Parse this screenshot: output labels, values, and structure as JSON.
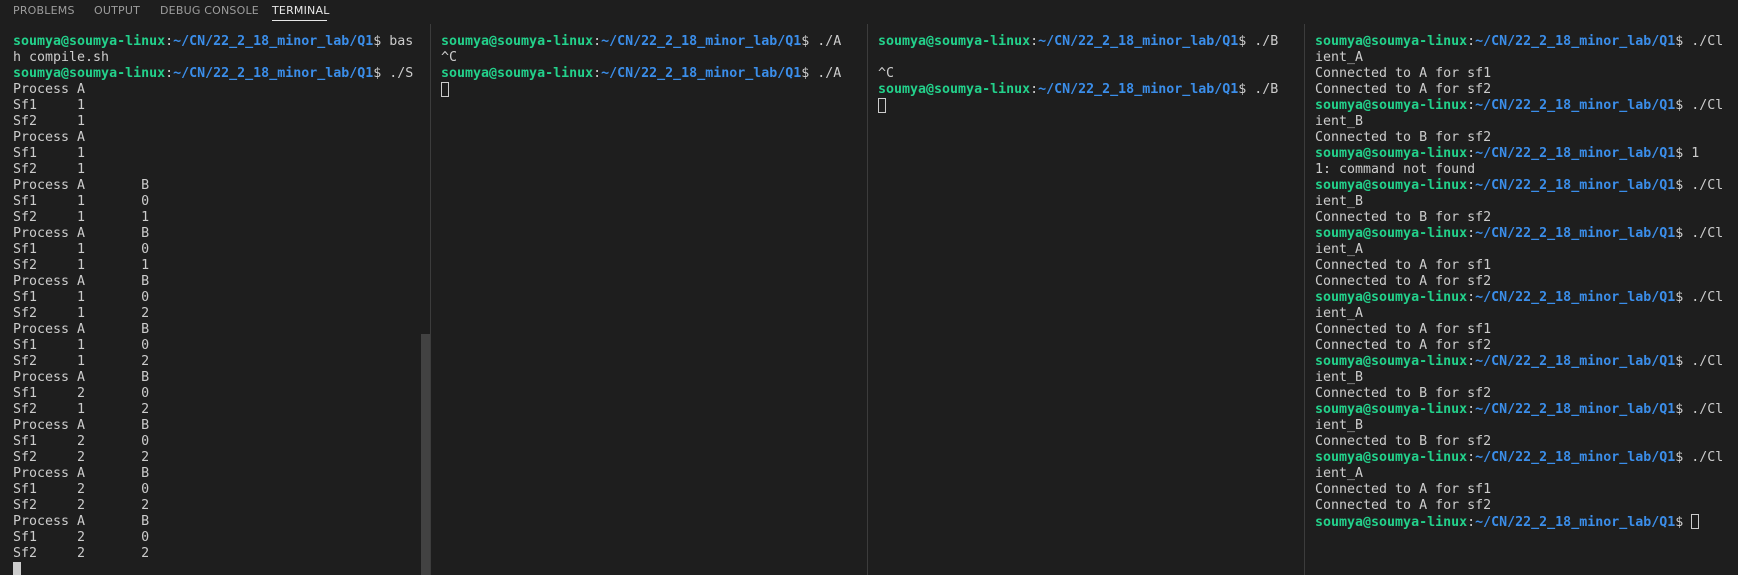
{
  "tabs": [
    {
      "label": "PROBLEMS",
      "active": false
    },
    {
      "label": "OUTPUT",
      "active": false
    },
    {
      "label": "DEBUG CONSOLE",
      "active": false
    },
    {
      "label": "TERMINAL",
      "active": true
    }
  ],
  "colors": {
    "background": "#1e1e1e",
    "text": "#cccccc",
    "prompt_user": "#23d18b",
    "prompt_path": "#3b8eea",
    "divider": "#3c3c3c",
    "scrollbar": "#424242"
  },
  "prompt": {
    "user": "soumya@soumya-linux",
    "separator": ":",
    "path": "~/CN/22_2_18_minor_lab/Q1",
    "symbol": "$ "
  },
  "panes": [
    {
      "name": "pane-1",
      "lines": [
        {
          "p": true,
          "t": "bas"
        },
        {
          "t": "h compile.sh"
        },
        {
          "p": true,
          "t": "./S"
        },
        {
          "t": "Process A"
        },
        {
          "t": "Sf1     1"
        },
        {
          "t": "Sf2     1"
        },
        {
          "t": "Process A"
        },
        {
          "t": "Sf1     1"
        },
        {
          "t": "Sf2     1"
        },
        {
          "t": "Process A       B"
        },
        {
          "t": "Sf1     1       0"
        },
        {
          "t": "Sf2     1       1"
        },
        {
          "t": "Process A       B"
        },
        {
          "t": "Sf1     1       0"
        },
        {
          "t": "Sf2     1       1"
        },
        {
          "t": "Process A       B"
        },
        {
          "t": "Sf1     1       0"
        },
        {
          "t": "Sf2     1       2"
        },
        {
          "t": "Process A       B"
        },
        {
          "t": "Sf1     1       0"
        },
        {
          "t": "Sf2     1       2"
        },
        {
          "t": "Process A       B"
        },
        {
          "t": "Sf1     2       0"
        },
        {
          "t": "Sf2     1       2"
        },
        {
          "t": "Process A       B"
        },
        {
          "t": "Sf1     2       0"
        },
        {
          "t": "Sf2     2       2"
        },
        {
          "t": "Process A       B"
        },
        {
          "t": "Sf1     2       0"
        },
        {
          "t": "Sf2     2       2"
        },
        {
          "t": "Process A       B"
        },
        {
          "t": "Sf1     2       0"
        },
        {
          "t": "Sf2     2       2"
        },
        {
          "t": "",
          "cursor": "filled"
        }
      ]
    },
    {
      "name": "pane-2",
      "lines": [
        {
          "p": true,
          "t": "./A"
        },
        {
          "t": "^C"
        },
        {
          "p": true,
          "t": "./A"
        },
        {
          "t": "",
          "cursor": "outline"
        }
      ]
    },
    {
      "name": "pane-3",
      "lines": [
        {
          "p": true,
          "t": "./B"
        },
        {
          "t": ""
        },
        {
          "t": "^C"
        },
        {
          "p": true,
          "t": "./B"
        },
        {
          "t": "",
          "cursor": "outline"
        }
      ]
    },
    {
      "name": "pane-4",
      "lines": [
        {
          "p": true,
          "t": "./Cl"
        },
        {
          "t": "ient_A"
        },
        {
          "t": "Connected to A for sf1"
        },
        {
          "t": "Connected to A for sf2"
        },
        {
          "p": true,
          "t": "./Cl"
        },
        {
          "t": "ient_B"
        },
        {
          "t": "Connected to B for sf2"
        },
        {
          "p": true,
          "t": "1"
        },
        {
          "t": "1: command not found"
        },
        {
          "p": true,
          "t": "./Cl"
        },
        {
          "t": "ient_B"
        },
        {
          "t": "Connected to B for sf2"
        },
        {
          "p": true,
          "t": "./Cl"
        },
        {
          "t": "ient_A"
        },
        {
          "t": "Connected to A for sf1"
        },
        {
          "t": "Connected to A for sf2"
        },
        {
          "p": true,
          "t": "./Cl"
        },
        {
          "t": "ient_A"
        },
        {
          "t": "Connected to A for sf1"
        },
        {
          "t": "Connected to A for sf2"
        },
        {
          "p": true,
          "t": "./Cl"
        },
        {
          "t": "ient_B"
        },
        {
          "t": "Connected to B for sf2"
        },
        {
          "p": true,
          "t": "./Cl"
        },
        {
          "t": "ient_B"
        },
        {
          "t": "Connected to B for sf2"
        },
        {
          "p": true,
          "t": "./Cl"
        },
        {
          "t": "ient_A"
        },
        {
          "t": "Connected to A for sf1"
        },
        {
          "t": "Connected to A for sf2"
        },
        {
          "p": true,
          "t": "",
          "cursor": "outline"
        }
      ]
    }
  ]
}
